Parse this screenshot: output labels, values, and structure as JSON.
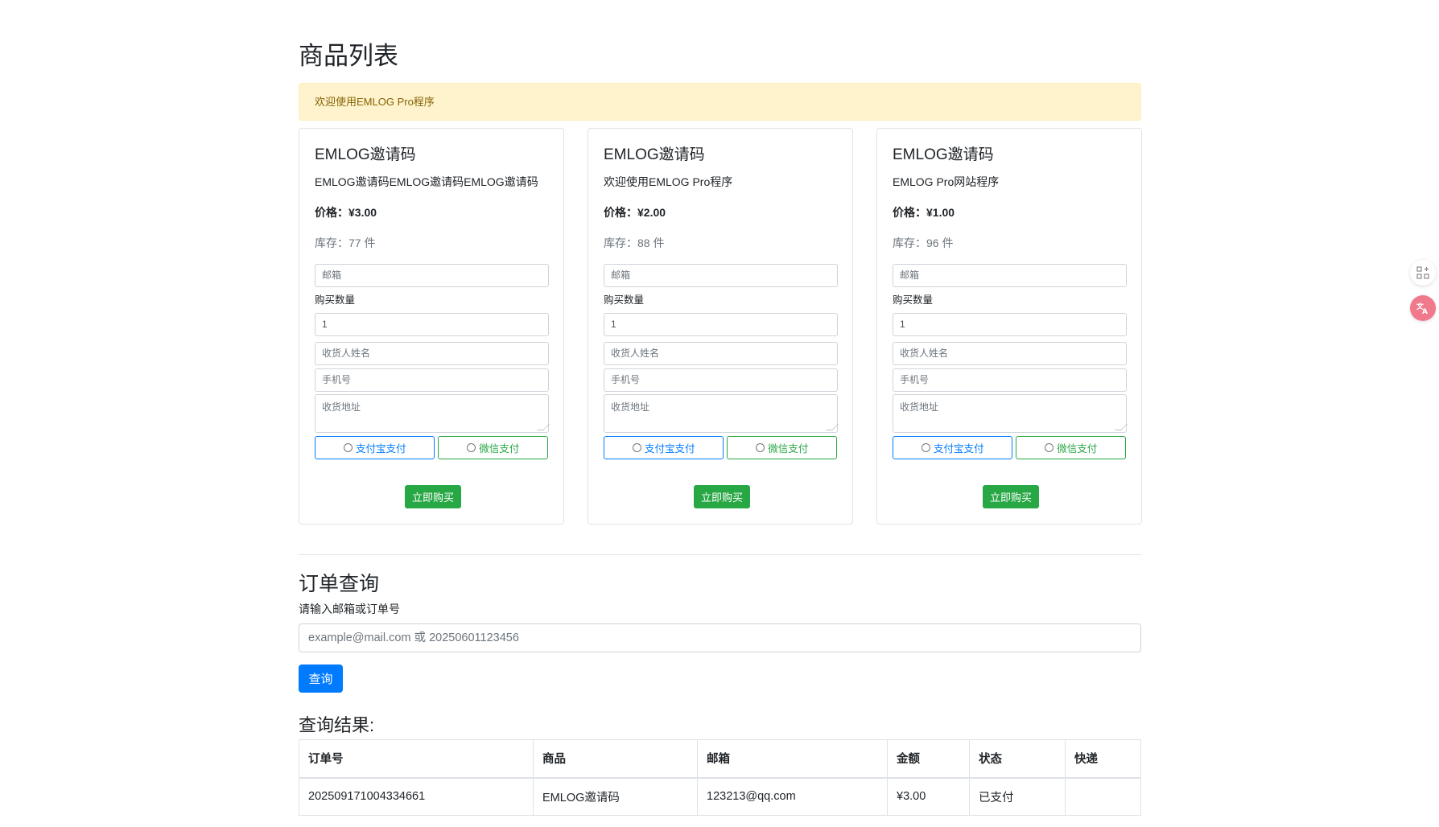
{
  "page": {
    "title": "商品列表"
  },
  "notice": "欢迎使用EMLOG Pro程序",
  "products": [
    {
      "name": "EMLOG邀请码",
      "description": "EMLOG邀请码EMLOG邀请码EMLOG邀请码",
      "price": "价格：¥3.00",
      "stock": "库存：77 件"
    },
    {
      "name": "EMLOG邀请码",
      "description": "欢迎使用EMLOG Pro程序",
      "price": "价格：¥2.00",
      "stock": "库存：88 件"
    },
    {
      "name": "EMLOG邀请码",
      "description": "EMLOG Pro网站程序",
      "price": "价格：¥1.00",
      "stock": "库存：96 件"
    }
  ],
  "form": {
    "email_placeholder": "邮箱",
    "quantity_label": "购买数量",
    "quantity_value": "1",
    "name_placeholder": "收货人姓名",
    "phone_placeholder": "手机号",
    "address_placeholder": "收货地址",
    "alipay_label": "支付宝支付",
    "wechat_label": "微信支付",
    "buy_label": "立即购买"
  },
  "query": {
    "title": "订单查询",
    "label": "请输入邮箱或订单号",
    "placeholder": "example@mail.com 或 20250601123456",
    "button": "查询"
  },
  "results": {
    "title": "查询结果:",
    "columns": [
      "订单号",
      "商品",
      "邮箱",
      "金额",
      "状态",
      "快递"
    ],
    "rows": [
      [
        "202509171004334661",
        "EMLOG邀请码",
        "123213@qq.com",
        "¥3.00",
        "已支付",
        ""
      ]
    ]
  },
  "colors": {
    "primary": "#007bff",
    "success": "#28a745",
    "warning_bg": "#fff3cd",
    "warning_text": "#856404"
  },
  "icons": {
    "side_tool_1": "qr-code-icon",
    "side_tool_2": "translate-icon"
  }
}
